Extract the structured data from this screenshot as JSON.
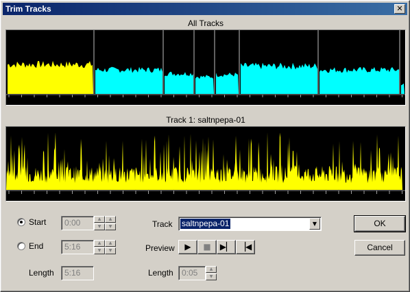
{
  "window": {
    "title": "Trim Tracks",
    "close_glyph": "✕"
  },
  "all_tracks": {
    "caption": "All Tracks",
    "segments": [
      {
        "color": "#ffff00",
        "level": 0.55
      },
      {
        "color": "#00ffff",
        "level": 0.45
      },
      {
        "color": "#00ffff",
        "level": 0.38
      },
      {
        "color": "#00ffff",
        "level": 0.32
      },
      {
        "color": "#00ffff",
        "level": 0.36
      },
      {
        "color": "#00ffff",
        "level": 0.52
      },
      {
        "color": "#00ffff",
        "level": 0.45
      },
      {
        "color": "#00ffff",
        "level": 0.18
      }
    ]
  },
  "track_view": {
    "caption": "Track 1: saltnpepa-01",
    "color": "#ffff00"
  },
  "range": {
    "start_label": "Start",
    "end_label": "End",
    "length_label": "Length",
    "start_value": "0:00",
    "end_value": "5:16",
    "length_value": "5:16",
    "selected": "start"
  },
  "track": {
    "label": "Track",
    "selected": "saltnpepa-01"
  },
  "preview": {
    "label": "Preview",
    "length_label": "Length",
    "length_value": "0:05",
    "play_glyph": "▶",
    "stop_glyph": "■",
    "next_glyph": "▶▏",
    "prev_glyph": "▕◀"
  },
  "buttons": {
    "ok": "OK",
    "cancel": "Cancel"
  },
  "icons": {
    "spin_up": "▲",
    "spin_down": "▼",
    "dropdown": "▼"
  }
}
